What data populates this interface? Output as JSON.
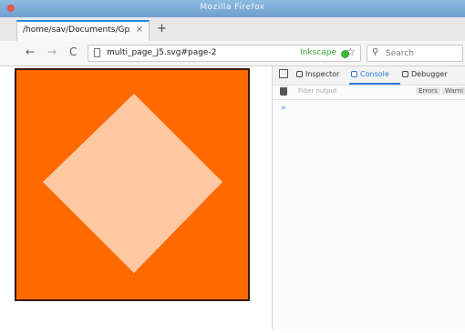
{
  "window": {
    "title": "Mozilla Firefox"
  },
  "tab": {
    "label": "/home/sav/Documents/Gpx",
    "close": "×"
  },
  "new_tab": "+",
  "nav": {
    "back": "←",
    "forward": "→",
    "reload": "C"
  },
  "url": {
    "value": "multi_page_J5.svg#page-2",
    "badge": "Inkscape"
  },
  "search": {
    "placeholder": "Search"
  },
  "devtools": {
    "tabs": [
      "Inspector",
      "Console",
      "Debugger"
    ],
    "active_tab": "Console",
    "filter_placeholder": "Filter output",
    "pills": [
      "Errors",
      "Warni"
    ],
    "prompt": "»"
  },
  "colors": {
    "svg_background": "#ff6a00",
    "diamond": "#ffc8a0",
    "svg_border": "#3b1a0a",
    "accent": "#2a7ae2"
  },
  "icons": [
    "close-dot-icon",
    "star-icon",
    "search-icon",
    "document-icon",
    "picker-icon",
    "trash-icon"
  ]
}
